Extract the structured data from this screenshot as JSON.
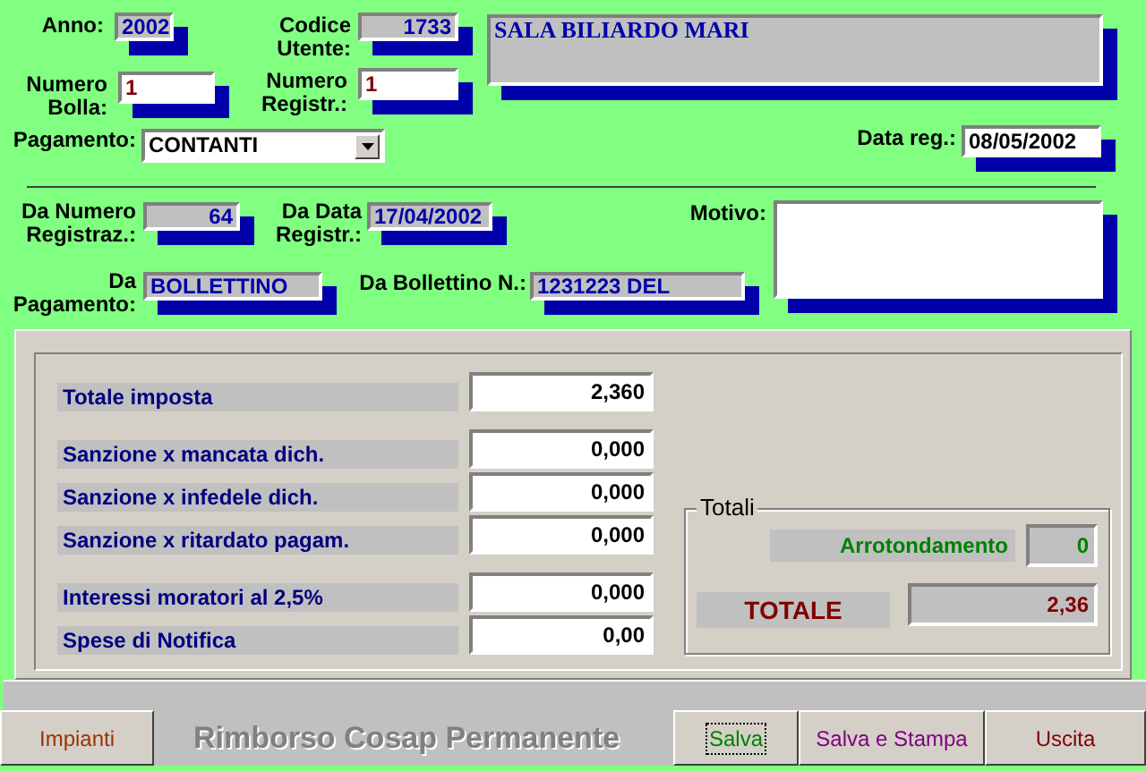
{
  "header_fields": [
    {
      "label": "Anno:",
      "value": "2002",
      "kind": "readonly"
    },
    {
      "label": "Codice Utente:",
      "value": "1733",
      "kind": "number"
    },
    {
      "value": "SALA BILIARDO MARI",
      "kind": "name"
    },
    {
      "label": "Numero Bolla:",
      "value": "1",
      "kind": "input"
    },
    {
      "label": "Numero Registr.:",
      "value": "1",
      "kind": "input"
    },
    {
      "label": "Pagamento:",
      "value": "CONTANTI",
      "kind": "combo"
    },
    {
      "label": "Data reg.:",
      "value": "08/05/2002",
      "kind": "date"
    },
    {
      "label": "Da Numero Registraz.:",
      "value": "64",
      "kind": "number"
    },
    {
      "label": "Da Data Registr.:",
      "value": "17/04/2002",
      "kind": "readonly"
    },
    {
      "label": "Motivo:",
      "kind": "memo"
    },
    {
      "label": "Da Pagamento:",
      "value": "BOLLETTINO",
      "kind": "readonly"
    },
    {
      "label": "Da Bollettino N.:",
      "value": "1231223 DEL",
      "kind": "readonly"
    }
  ],
  "amounts": [
    {
      "label": "Totale imposta",
      "value": "2,360"
    },
    {
      "label": "Sanzione x mancata dich.",
      "value": "0,000"
    },
    {
      "label": "Sanzione x infedele dich.",
      "value": "0,000"
    },
    {
      "label": "Sanzione x ritardato pagam.",
      "value": "0,000"
    },
    {
      "label": "Interessi moratori al 2,5%",
      "value": "0,000"
    },
    {
      "label": "Spese di Notifica",
      "value": "0,00"
    }
  ],
  "totals": {
    "title": "Totali",
    "rounding_label": "Arrotondamento",
    "rounding_value": "0",
    "total_label": "TOTALE",
    "total_value": "2,36"
  },
  "footer": [
    {
      "kind": "button",
      "label": "Impianti",
      "color": "#993300",
      "focused": false
    },
    {
      "kind": "title",
      "label": "Rimborso Cosap Permanente"
    },
    {
      "kind": "button",
      "label": "Salva",
      "color": "#008000",
      "focused": true
    },
    {
      "kind": "button",
      "label": "Salva e Stampa",
      "color": "#800080",
      "focused": false
    },
    {
      "kind": "button",
      "label": "Uscita",
      "color": "#800000",
      "focused": false
    }
  ]
}
